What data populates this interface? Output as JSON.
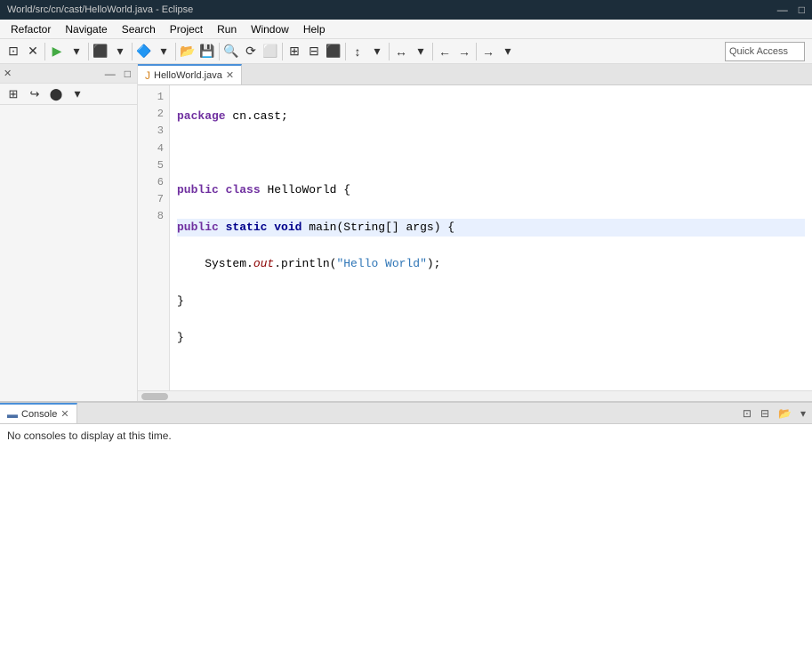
{
  "title_bar": {
    "title": "World/src/cn/cast/HelloWorld.java - Eclipse",
    "minimize_btn": "—",
    "maximize_btn": "□"
  },
  "menu": {
    "items": [
      "Refactor",
      "Navigate",
      "Search",
      "Project",
      "Run",
      "Window",
      "Help"
    ]
  },
  "toolbar": {
    "quick_access_label": "Quick Access"
  },
  "left_panel": {
    "close_icon": "✕",
    "minimize_icon": "—",
    "maximize_icon": "□",
    "toolbar_icons": [
      "⊞",
      "↪",
      "⬤"
    ]
  },
  "editor": {
    "tab_name": "HelloWorld.java",
    "tab_close": "✕",
    "lines": [
      {
        "num": 1,
        "content": "package cn.cast;",
        "type": "normal"
      },
      {
        "num": 2,
        "content": "",
        "type": "normal"
      },
      {
        "num": 3,
        "content": "public class HelloWorld {",
        "type": "normal"
      },
      {
        "num": 4,
        "content": "    public static void main(String[] args) {",
        "type": "highlighted"
      },
      {
        "num": 5,
        "content": "        System.out.println(\"Hello World\");",
        "type": "normal"
      },
      {
        "num": 6,
        "content": "    }",
        "type": "normal"
      },
      {
        "num": 7,
        "content": "}",
        "type": "normal"
      },
      {
        "num": 8,
        "content": "",
        "type": "normal"
      }
    ]
  },
  "console": {
    "tab_name": "Console",
    "tab_close": "✕",
    "no_console_msg": "No consoles to display at this time."
  }
}
